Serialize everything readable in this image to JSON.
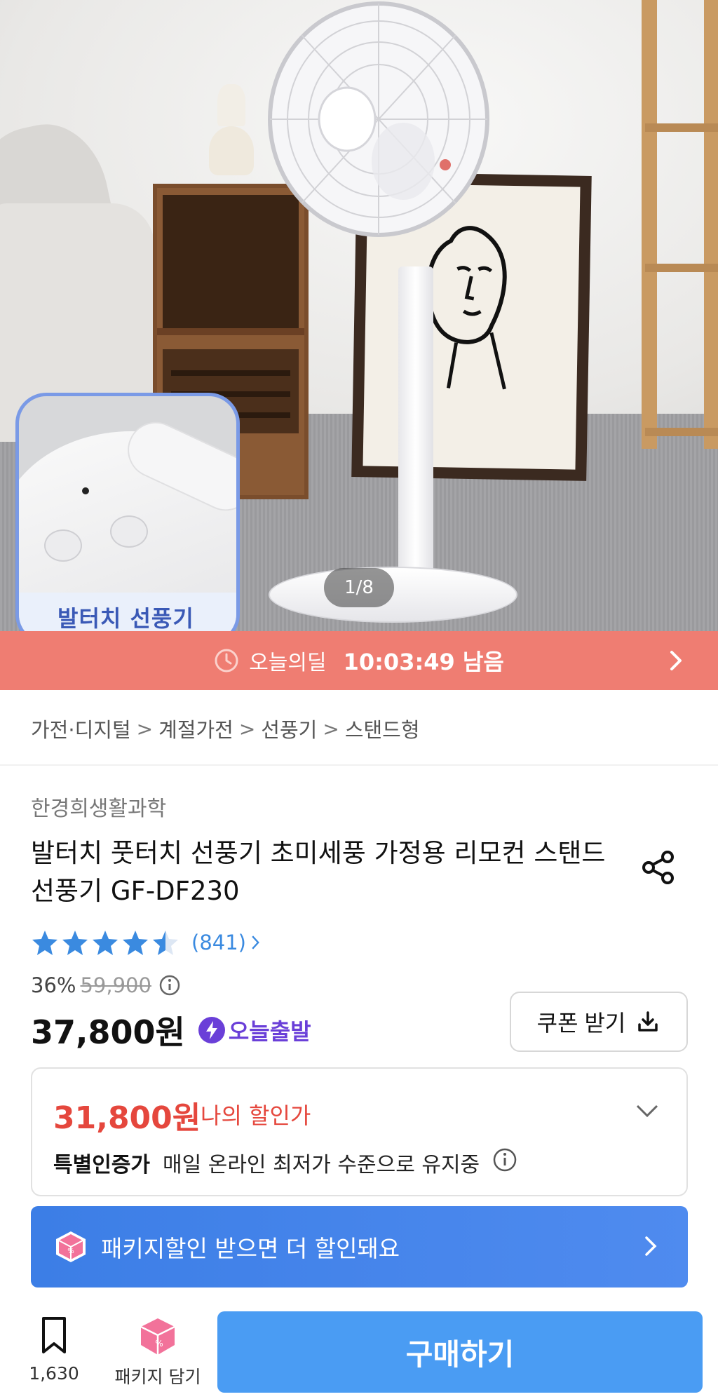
{
  "gallery": {
    "counter": "1/8",
    "thumb_label": "발터치 선풍기"
  },
  "deal": {
    "label": "오늘의딜",
    "remaining": "10:03:49 남음"
  },
  "breadcrumb": [
    "가전·디지털",
    "계절가전",
    "선풍기",
    "스탠드형"
  ],
  "product": {
    "brand": "한경희생활과학",
    "title": "발터치 풋터치 선풍기 초미세풍 가정용 리모컨 스탠드선풍기 GF-DF230",
    "rating": 4.5,
    "review_count": "(841)",
    "discount_rate": "36%",
    "original_price": "59,900",
    "price": "37,800원",
    "delivery_badge": "오늘출발",
    "coupon_label": "쿠폰 받기"
  },
  "my_price": {
    "price": "31,800원",
    "label": "나의 할인가",
    "special_title": "특별인증가",
    "special_desc": "매일 온라인 최저가 수준으로 유지중"
  },
  "package_banner": {
    "text": "패키지할인 받으면 더 할인돼요"
  },
  "bottom_bar": {
    "bookmark_count": "1,630",
    "package_add_label": "패키지 담기",
    "buy_label": "구매하기"
  },
  "colors": {
    "deal_bar": "#ef7d72",
    "star": "#3a8ae0",
    "my_price": "#e5473d",
    "today_badge": "#6a3fd8",
    "package_banner": "#3c7ee6",
    "buy_button": "#4a9cf3"
  },
  "icons": {
    "deal_clock": "clock-icon",
    "deal_chevron": "chevron-right-icon",
    "share": "share-icon",
    "info": "info-icon",
    "bolt": "bolt-icon",
    "coupon": "download-icon",
    "expand": "chevron-down-icon",
    "package": "package-box-icon",
    "bookmark": "bookmark-icon"
  }
}
